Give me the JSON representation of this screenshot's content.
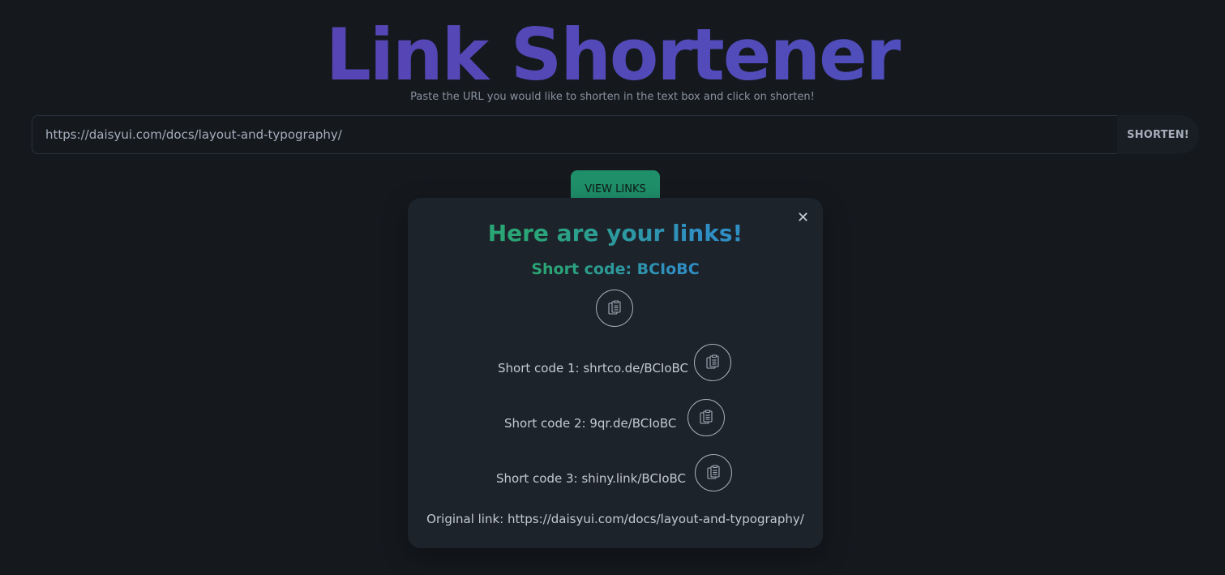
{
  "header": {
    "title": "Link Shortener",
    "subtitle": "Paste the URL you would like to shorten in the text box and click on shorten!"
  },
  "form": {
    "url_value": "https://daisyui.com/docs/layout-and-typography/",
    "shorten_label": "SHORTEN!",
    "view_links_label": "VIEW LINKS"
  },
  "modal": {
    "close_label": "✕",
    "heading": "Here are your links!",
    "short_code_main": "Short code: BCIoBC",
    "links": [
      {
        "label": "Short code 1: shrtco.de/BCIoBC"
      },
      {
        "label": "Short code 2: 9qr.de/BCIoBC"
      },
      {
        "label": "Short code 3: shiny.link/BCIoBC"
      }
    ],
    "original": "Original link: https://daisyui.com/docs/layout-and-typography/"
  },
  "colors": {
    "background": "#15191e",
    "modal_bg": "#1d232a",
    "title_gradient": [
      "#5b3fb0",
      "#4b54c0"
    ],
    "accent_gradient": [
      "#2aa576",
      "#2f8fc4"
    ],
    "view_links_bg": "#1f8f6a"
  },
  "icons": {
    "copy": "clipboard-copy-icon",
    "close": "close-icon"
  }
}
